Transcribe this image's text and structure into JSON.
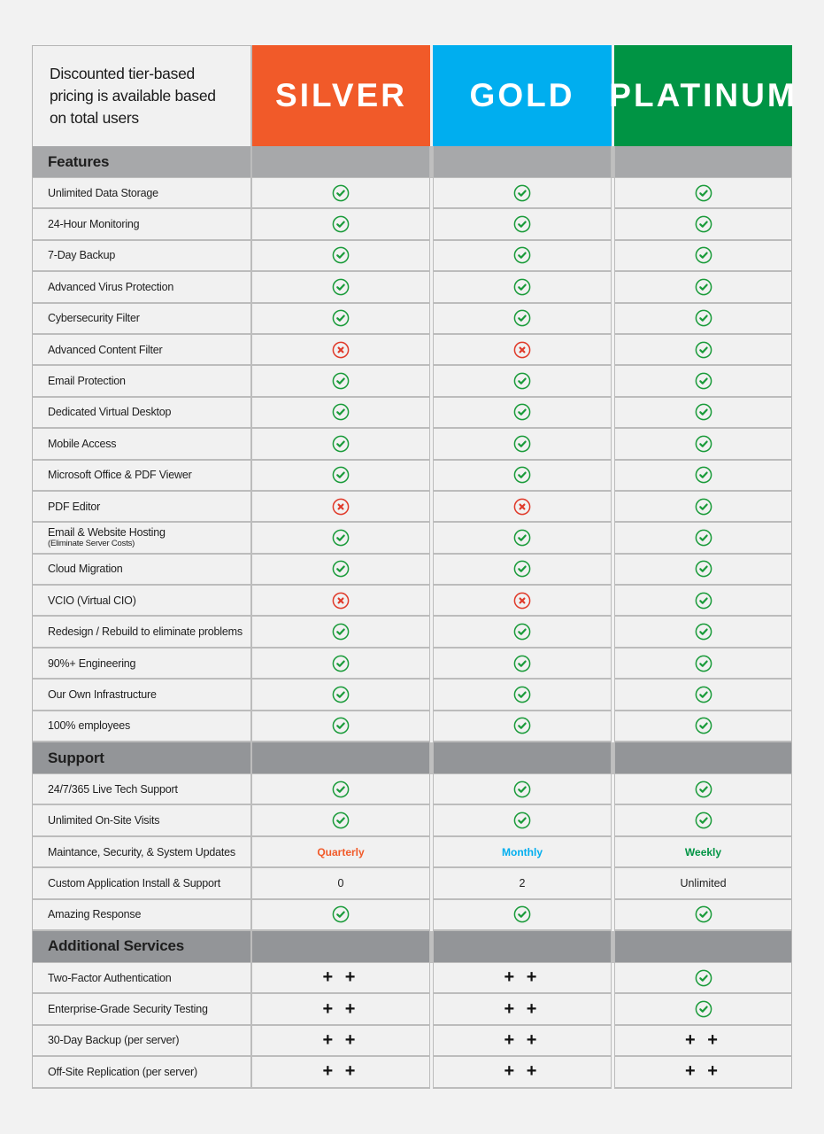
{
  "header": {
    "intro": "Discounted tier-based pricing is available based on total users",
    "tiers": [
      {
        "name": "SILVER",
        "color": "#f15a29"
      },
      {
        "name": "GOLD",
        "color": "#00aeef"
      },
      {
        "name": "PLATINUM",
        "color": "#009444"
      }
    ]
  },
  "status_colors": {
    "check": "#1a9b3a",
    "cross": "#e03a2a"
  },
  "sections": [
    {
      "title": "Features",
      "rows": [
        {
          "label": "Unlimited Data Storage",
          "values": [
            "check",
            "check",
            "check"
          ]
        },
        {
          "label": "24-Hour Monitoring",
          "values": [
            "check",
            "check",
            "check"
          ]
        },
        {
          "label": "7-Day Backup",
          "values": [
            "check",
            "check",
            "check"
          ]
        },
        {
          "label": "Advanced Virus Protection",
          "values": [
            "check",
            "check",
            "check"
          ]
        },
        {
          "label": "Cybersecurity Filter",
          "values": [
            "check",
            "check",
            "check"
          ]
        },
        {
          "label": "Advanced Content Filter",
          "values": [
            "cross",
            "cross",
            "check"
          ]
        },
        {
          "label": "Email Protection",
          "values": [
            "check",
            "check",
            "check"
          ]
        },
        {
          "label": "Dedicated Virtual Desktop",
          "values": [
            "check",
            "check",
            "check"
          ]
        },
        {
          "label": "Mobile Access",
          "values": [
            "check",
            "check",
            "check"
          ]
        },
        {
          "label": "Microsoft Office & PDF Viewer",
          "values": [
            "check",
            "check",
            "check"
          ]
        },
        {
          "label": "PDF Editor",
          "values": [
            "cross",
            "cross",
            "check"
          ]
        },
        {
          "label": "Email & Website Hosting",
          "sublabel": "(Eliminate Server Costs)",
          "values": [
            "check",
            "check",
            "check"
          ]
        },
        {
          "label": "Cloud Migration",
          "values": [
            "check",
            "check",
            "check"
          ]
        },
        {
          "label": "VCIO (Virtual CIO)",
          "values": [
            "cross",
            "cross",
            "check"
          ]
        },
        {
          "label": "Redesign / Rebuild to eliminate problems",
          "values": [
            "check",
            "check",
            "check"
          ]
        },
        {
          "label": "90%+ Engineering",
          "values": [
            "check",
            "check",
            "check"
          ]
        },
        {
          "label": "Our Own Infrastructure",
          "values": [
            "check",
            "check",
            "check"
          ]
        },
        {
          "label": "100% employees",
          "values": [
            "check",
            "check",
            "check"
          ]
        }
      ]
    },
    {
      "title": "Support",
      "rows": [
        {
          "label": "24/7/365 Live Tech Support",
          "values": [
            "check",
            "check",
            "check"
          ]
        },
        {
          "label": "Unlimited On-Site  Visits",
          "values": [
            "check",
            "check",
            "check"
          ]
        },
        {
          "label": "Maintance, Security, & System Updates",
          "values": [
            "text:Quarterly",
            "text:Monthly",
            "text:Weekly"
          ],
          "colored": true
        },
        {
          "label": "Custom Application Install & Support",
          "values": [
            "text:0",
            "text:2",
            "text:Unlimited"
          ]
        },
        {
          "label": "Amazing Response",
          "values": [
            "check",
            "check",
            "check"
          ]
        }
      ]
    },
    {
      "title": "Additional Services",
      "rows": [
        {
          "label": "Two-Factor Authentication",
          "values": [
            "plus",
            "plus",
            "check"
          ]
        },
        {
          "label": "Enterprise-Grade Security Testing",
          "values": [
            "plus",
            "plus",
            "check"
          ]
        },
        {
          "label": "30-Day Backup (per server)",
          "values": [
            "plus",
            "plus",
            "plus"
          ]
        },
        {
          "label": "Off-Site Replication (per server)",
          "values": [
            "plus",
            "plus",
            "plus"
          ]
        }
      ]
    }
  ],
  "plus_symbol": "+ +"
}
